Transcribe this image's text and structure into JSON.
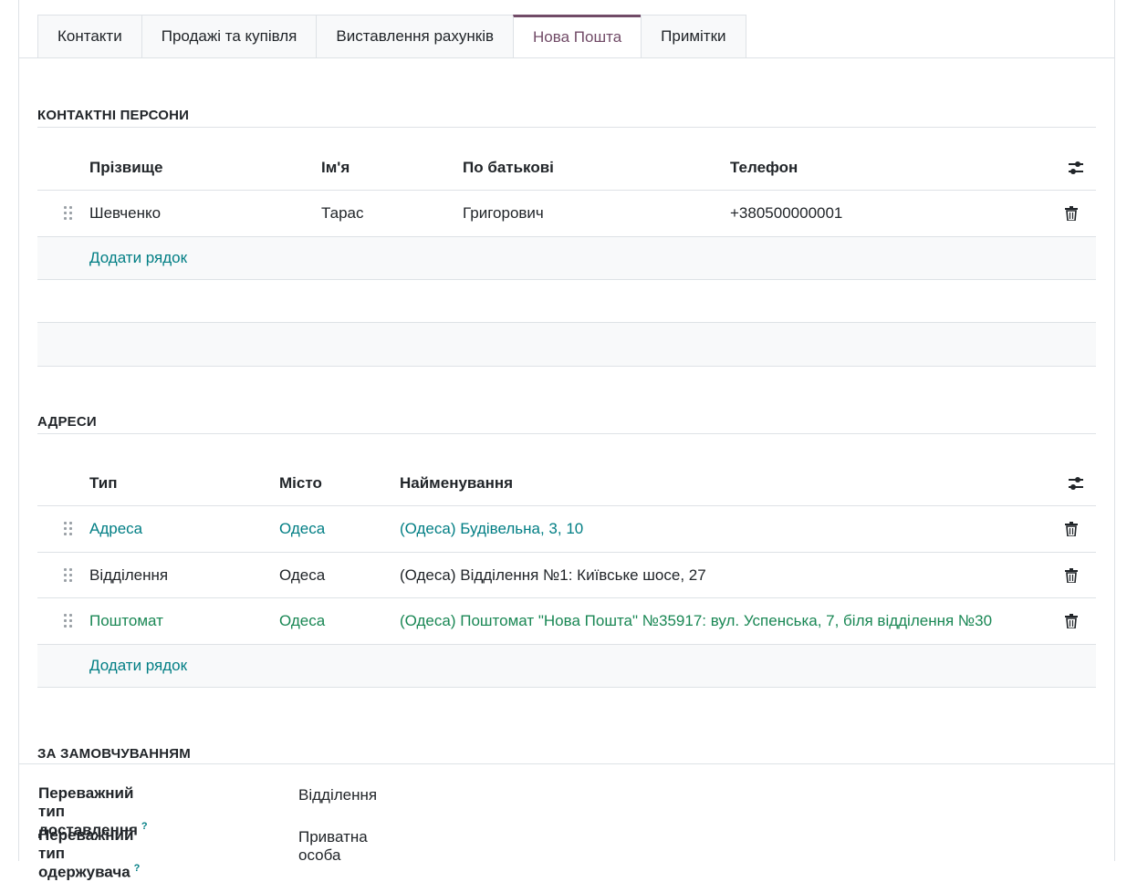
{
  "tabs": [
    {
      "label": "Контакти",
      "active": false
    },
    {
      "label": "Продажі та купівля",
      "active": false
    },
    {
      "label": "Виставлення рахунків",
      "active": false
    },
    {
      "label": "Нова Пошта",
      "active": true
    },
    {
      "label": "Примітки",
      "active": false
    }
  ],
  "contacts": {
    "title": "КОНТАКТНІ ПЕРСОНИ",
    "columns": {
      "surname": "Прізвище",
      "name": "Ім'я",
      "patronymic": "По батькові",
      "phone": "Телефон"
    },
    "rows": [
      {
        "surname": "Шевченко",
        "name": "Тарас",
        "patronymic": "Григорович",
        "phone": "+380500000001"
      }
    ],
    "add_label": "Додати рядок"
  },
  "addresses": {
    "title": "АДРЕСИ",
    "columns": {
      "type": "Тип",
      "city": "Місто",
      "name": "Найменування"
    },
    "rows": [
      {
        "type": "Адреса",
        "city": "Одеса",
        "name": "(Одеса) Будівельна, 3, 10",
        "color": "#017e84"
      },
      {
        "type": "Відділення",
        "city": "Одеса",
        "name": "(Одеса) Відділення №1: Київське шосе, 27",
        "color": "#212529"
      },
      {
        "type": "Поштомат",
        "city": "Одеса",
        "name": "(Одеса) Поштомат \"Нова Пошта\" №35917: вул. Успенська, 7, біля відділення №30",
        "color": "#198754"
      }
    ],
    "add_label": "Додати рядок"
  },
  "defaults": {
    "title": "ЗА ЗАМОВЧУВАННЯМ",
    "delivery_type_label": "Переважний тип доставлення",
    "delivery_type_value": "Відділення",
    "recipient_type_label": "Переважний тип одержувача",
    "recipient_type_value": "Приватна особа",
    "help_mark": "?"
  },
  "colors": {
    "accent": "#714B67",
    "link": "#017e84",
    "success": "#198754"
  }
}
